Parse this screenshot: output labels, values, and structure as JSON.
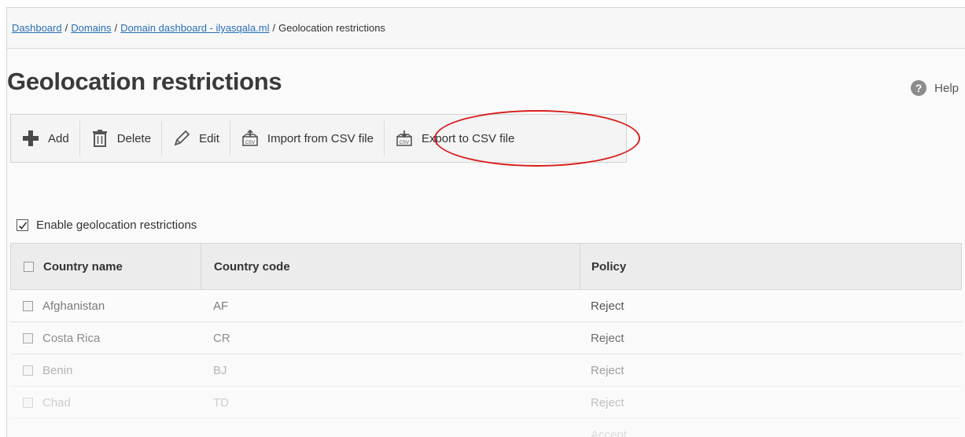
{
  "breadcrumb": {
    "items": [
      "Dashboard",
      "Domains",
      "Domain dashboard - ilyasqala.ml"
    ],
    "current": "Geolocation restrictions",
    "separator": "/"
  },
  "page": {
    "title": "Geolocation restrictions",
    "help_label": "Help"
  },
  "toolbar": {
    "add_label": "Add",
    "delete_label": "Delete",
    "edit_label": "Edit",
    "import_label": "Import from CSV file",
    "export_label": "Export to CSV file"
  },
  "enable": {
    "label": "Enable geolocation restrictions",
    "checked": true
  },
  "table": {
    "headers": [
      "Country name",
      "Country code",
      "Policy"
    ],
    "rows": [
      {
        "name": "Afghanistan",
        "code": "AF",
        "policy": "Reject"
      },
      {
        "name": "Costa Rica",
        "code": "CR",
        "policy": "Reject"
      },
      {
        "name": "Benin",
        "code": "BJ",
        "policy": "Reject"
      },
      {
        "name": "Chad",
        "code": "TD",
        "policy": "Reject"
      },
      {
        "name": "",
        "code": "",
        "policy": "Accept"
      }
    ]
  },
  "colors": {
    "link": "#2a6fb8",
    "highlight": "#d91c1c",
    "add_icon": "#4a4a4a"
  },
  "icons": [
    "plus-icon",
    "trash-icon",
    "pencil-icon",
    "csv-import-icon",
    "csv-export-icon",
    "help-icon",
    "checkmark-icon"
  ]
}
